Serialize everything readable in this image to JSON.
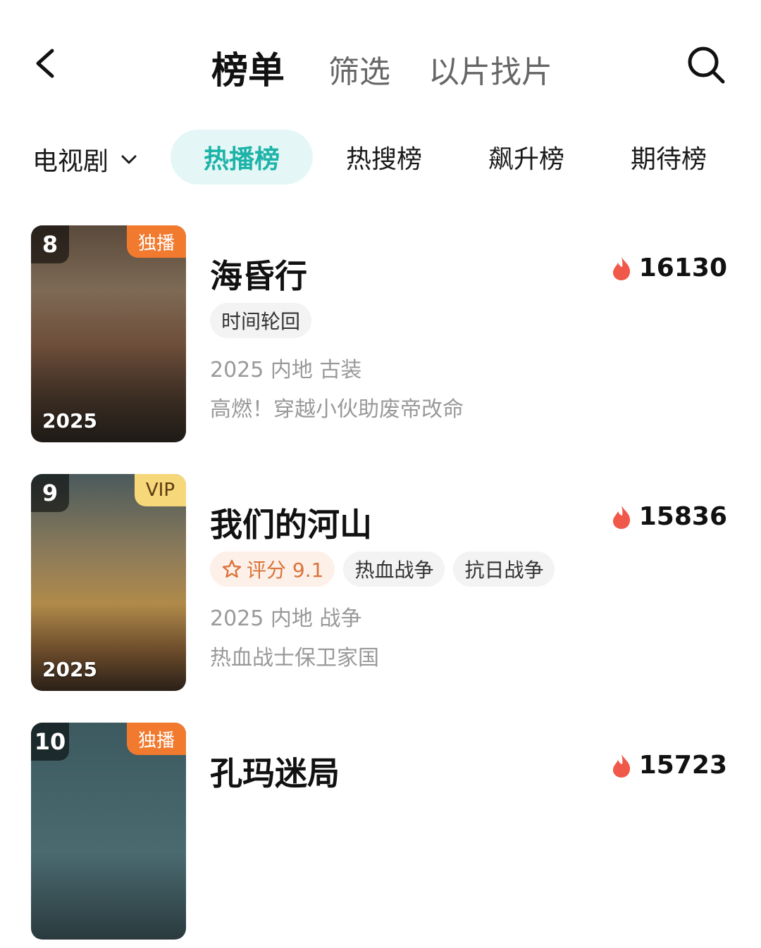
{
  "header": {
    "title": "榜单",
    "tabs": [
      "筛选",
      "以片找片"
    ]
  },
  "filter": {
    "category": "电视剧",
    "pills": [
      "热播榜",
      "热搜榜",
      "飙升榜",
      "期待榜"
    ],
    "active_index": 0
  },
  "items": [
    {
      "rank": "8",
      "badge": "独播",
      "year": "2025",
      "title": "海昏行",
      "hot": "16130",
      "tags": [
        "时间轮回"
      ],
      "meta": "2025 内地 古装",
      "desc": "高燃！穿越小伙助废帝改命"
    },
    {
      "rank": "9",
      "badge": "VIP",
      "year": "2025",
      "title": "我们的河山",
      "hot": "15836",
      "score": "评分 9.1",
      "tags": [
        "热血战争",
        "抗日战争"
      ],
      "meta": "2025 内地 战争",
      "desc": "热血战士保卫家国"
    },
    {
      "rank": "10",
      "badge": "独播",
      "title": "孔玛迷局",
      "hot": "15723"
    }
  ],
  "colors": {
    "accent": "#1db3a8",
    "accent_bg": "#e4f7f6",
    "exclusive_badge": "#f27a2f",
    "vip_badge": "#f6d77a",
    "flame": "#f0584a",
    "score": "#d9733a"
  }
}
